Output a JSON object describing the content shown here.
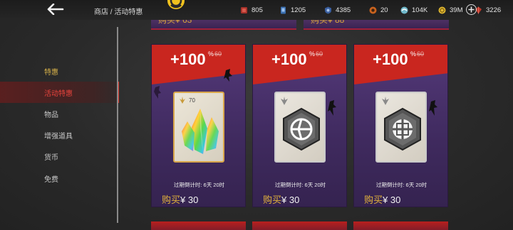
{
  "topbar": {
    "breadcrumb": "商店 / 活动特惠",
    "currencies": [
      {
        "icon": "red-gem-icon",
        "value": "805",
        "color": "#c0392b"
      },
      {
        "icon": "blue-card-icon",
        "value": "1205",
        "color": "#3a6fb0"
      },
      {
        "icon": "blue-shield-icon",
        "value": "4385",
        "color": "#3a5fa0"
      },
      {
        "icon": "orange-core-icon",
        "value": "20",
        "color": "#d9822b"
      },
      {
        "icon": "teal-orb-icon",
        "value": "104K",
        "color": "#6fb7c9"
      },
      {
        "icon": "gold-coin-icon",
        "value": "39M",
        "color": "#e0b830"
      },
      {
        "icon": "red-crystal-icon",
        "value": "3226",
        "color": "#c0392b"
      }
    ]
  },
  "sidebar": {
    "items": [
      {
        "label": "特惠",
        "state": "gold"
      },
      {
        "label": "活动特惠",
        "state": "active"
      },
      {
        "label": "物品",
        "state": "plain"
      },
      {
        "label": "增强道具",
        "state": "plain"
      },
      {
        "label": "货币",
        "state": "plain"
      },
      {
        "label": "免费",
        "state": "plain"
      }
    ]
  },
  "top_strips": [
    {
      "text": "购买¥ 63"
    },
    {
      "text": "购买¥ 88"
    }
  ],
  "cards": [
    {
      "bonus": "+100",
      "pct": "%",
      "old": "60",
      "qty": "70",
      "item_icon": "rainbow-crystal-icon",
      "timer": "过期倒计时:  6天 20时",
      "buy": "购买",
      "price": "¥ 30"
    },
    {
      "bonus": "+100",
      "pct": "%",
      "old": "60",
      "qty": "",
      "item_icon": "hexagon-emblem-icon",
      "timer": "过期倒计时:  6天 20时",
      "buy": "购买",
      "price": "¥ 30"
    },
    {
      "bonus": "+100",
      "pct": "%",
      "old": "60",
      "qty": "",
      "item_icon": "hexagon-cross-emblem-icon",
      "timer": "过期倒计时:  6天 20时",
      "buy": "购买",
      "price": "¥ 30"
    }
  ],
  "colors": {
    "accent_red": "#c9261f",
    "gold": "#e3b23c",
    "card_purple": "#4a3270"
  }
}
